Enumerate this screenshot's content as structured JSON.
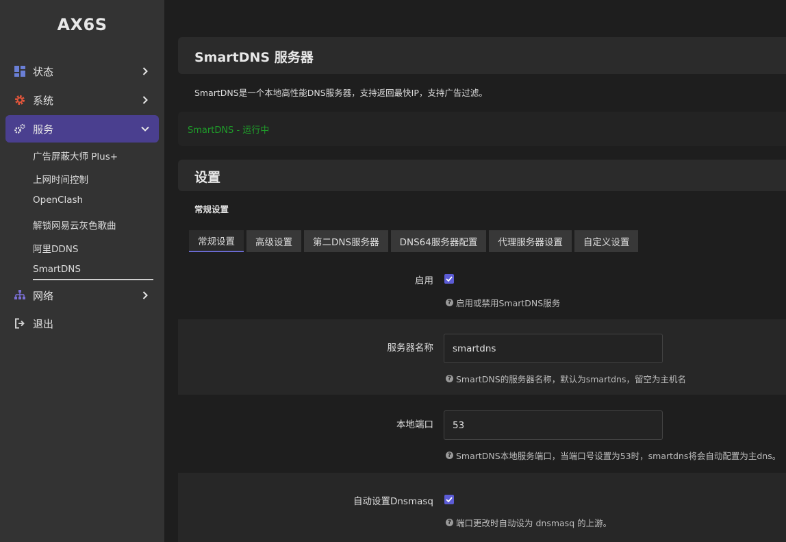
{
  "sidebar": {
    "brand": "AX6S",
    "items": [
      {
        "label": "状态"
      },
      {
        "label": "系统"
      },
      {
        "label": "服务"
      },
      {
        "label": "网络"
      },
      {
        "label": "退出"
      }
    ],
    "sub_items": [
      {
        "label": "广告屏蔽大师 Plus+"
      },
      {
        "label": "上网时间控制"
      },
      {
        "label": "OpenClash"
      },
      {
        "label": "解锁网易云灰色歌曲"
      },
      {
        "label": "阿里DDNS"
      },
      {
        "label": "SmartDNS"
      }
    ],
    "accent_color": "#4a3f8f"
  },
  "main": {
    "page_title": "SmartDNS 服务器",
    "description": "SmartDNS是一个本地高性能DNS服务器，支持返回最快IP，支持广告过滤。",
    "status_text": "SmartDNS - 运行中",
    "status_color": "#1f9e2a",
    "section_title": "设置",
    "subsection_title": "常规设置",
    "tabs": [
      {
        "label": "常规设置"
      },
      {
        "label": "高级设置"
      },
      {
        "label": "第二DNS服务器"
      },
      {
        "label": "DNS64服务器配置"
      },
      {
        "label": "代理服务器设置"
      },
      {
        "label": "自定义设置"
      }
    ],
    "fields": {
      "enable": {
        "label": "启用",
        "checked": true,
        "help": "启用或禁用SmartDNS服务"
      },
      "server_name": {
        "label": "服务器名称",
        "value": "smartdns",
        "help": "SmartDNS的服务器名称，默认为smartdns，留空为主机名"
      },
      "local_port": {
        "label": "本地端口",
        "value": "53",
        "help": "SmartDNS本地服务端口，当端口号设置为53时，smartdns将会自动配置为主dns。"
      },
      "auto_dnsmasq": {
        "label": "自动设置Dnsmasq",
        "checked": true,
        "help": "端口更改时自动设为 dnsmasq 的上游。"
      }
    }
  }
}
